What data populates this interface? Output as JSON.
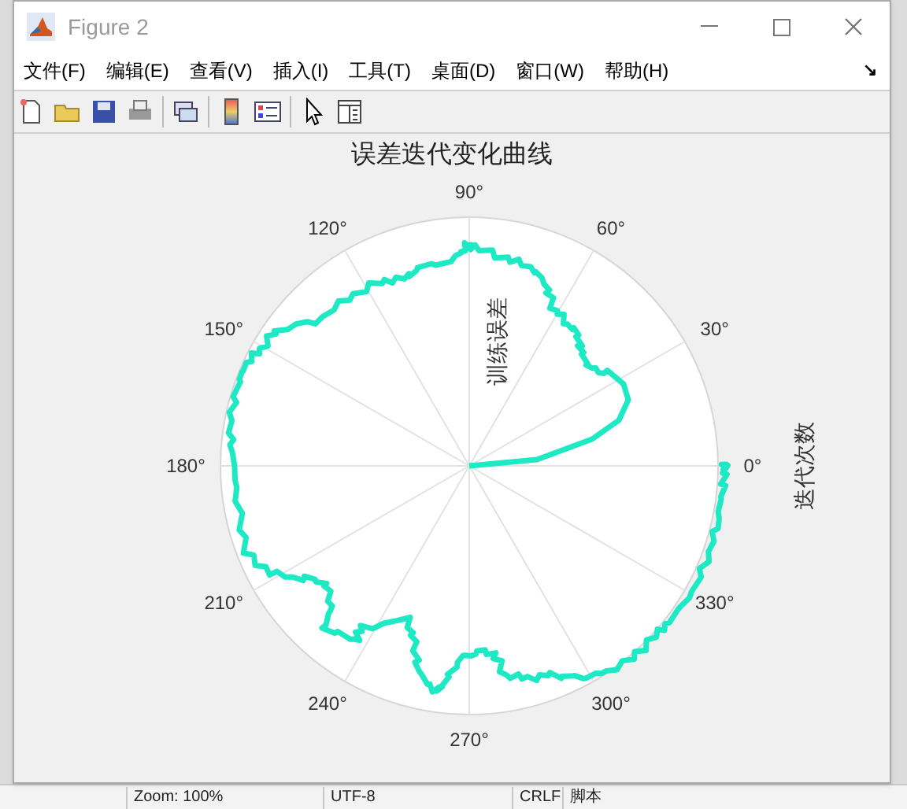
{
  "window": {
    "title": "Figure 2"
  },
  "menu": [
    "文件(F)",
    "编辑(E)",
    "查看(V)",
    "插入(I)",
    "工具(T)",
    "桌面(D)",
    "窗口(W)",
    "帮助(H)"
  ],
  "menu_corner": "↘",
  "plot": {
    "title": "误差迭代变化曲线",
    "r_label": "训练误差",
    "outer_label": "迭代次数",
    "angle_labels": [
      "0°",
      "30°",
      "60°",
      "90°",
      "120°",
      "150°",
      "180°",
      "210°",
      "240°",
      "270°",
      "300°",
      "330°"
    ]
  },
  "background_status_bar": [
    "Zoom: 100%",
    "UTF-8",
    "CRLF",
    "脚本"
  ]
}
